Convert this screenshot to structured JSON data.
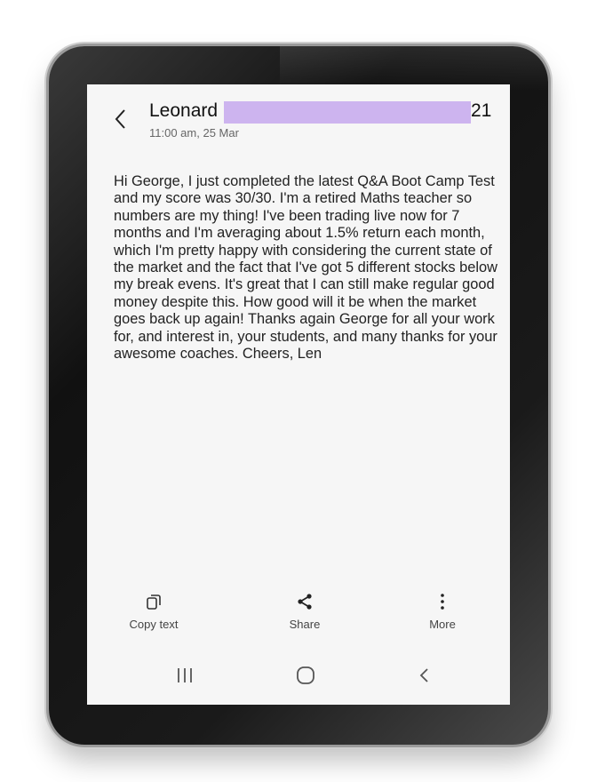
{
  "header": {
    "sender_name": "Leonard",
    "sender_suffix": "21",
    "timestamp": "11:00 am, 25 Mar",
    "redaction_color": "#cdb4ef"
  },
  "message": {
    "body": "Hi George, I just completed the latest Q&A Boot Camp Test and my score was 30/30. I'm a retired Maths teacher so numbers are my thing! I've been trading live now for 7 months and I'm averaging about 1.5% return each month, which I'm pretty happy with considering the current state of the market and the fact that I've got 5 different stocks below my break evens. It's great that I can still make regular good money despite this. How good will it be when the market goes back up again! Thanks again George for all your work for, and interest in, your students, and many thanks for your awesome coaches. Cheers, Len"
  },
  "actions": [
    {
      "label": "Copy text",
      "icon": "copy-icon"
    },
    {
      "label": "Share",
      "icon": "share-icon"
    },
    {
      "label": "More",
      "icon": "more-vertical-icon"
    }
  ],
  "nav": {
    "recents_icon": "recents-icon",
    "home_icon": "home-icon",
    "back_icon": "back-icon"
  }
}
